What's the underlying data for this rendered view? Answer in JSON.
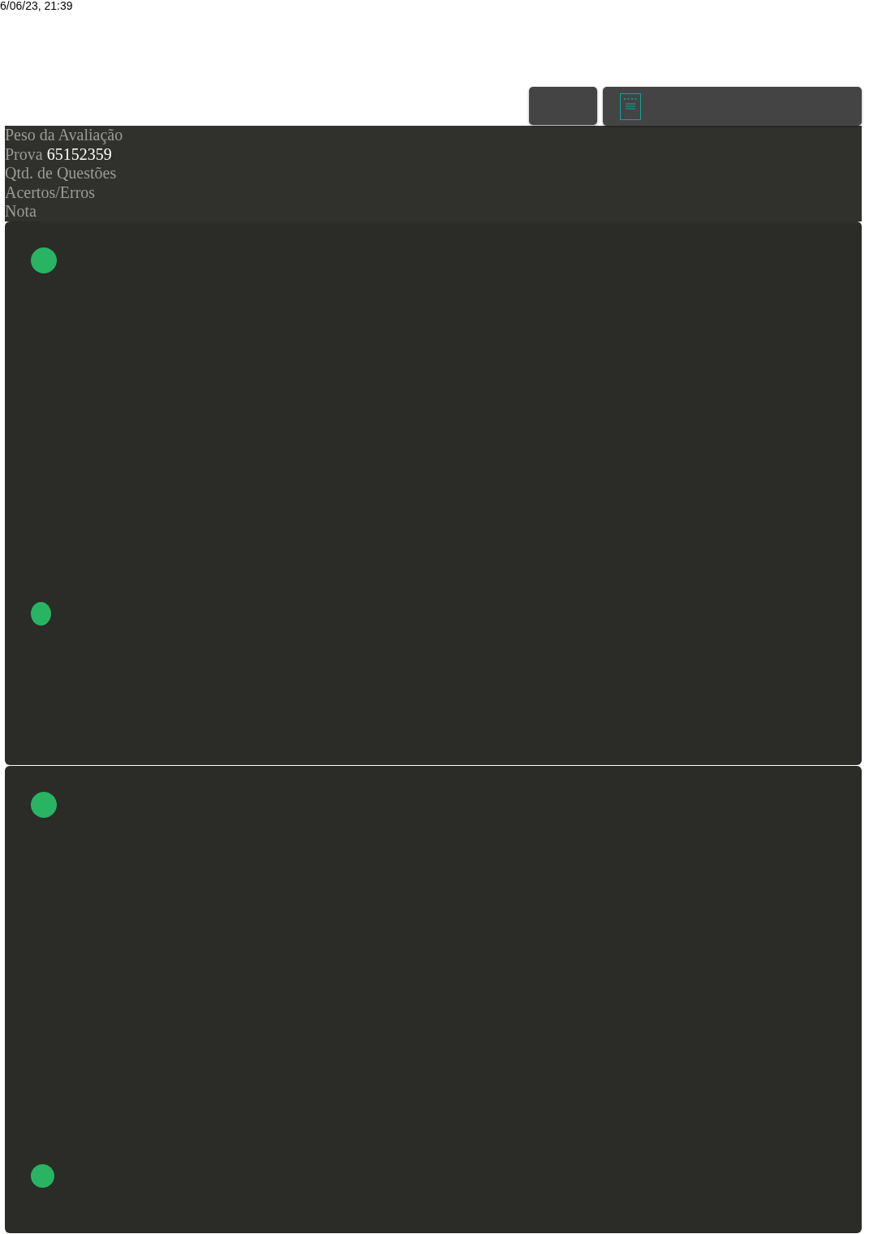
{
  "timestamp": "6/06/23, 21:39",
  "info": [
    {
      "label": "Peso da Avaliação"
    },
    {
      "label": "Prova",
      "value": "65152359"
    },
    {
      "label": "Qtd. de Questões"
    },
    {
      "label": "Acertos/Erros"
    },
    {
      "label": "Nota"
    }
  ],
  "cards": [
    {
      "kind": "question"
    },
    {
      "kind": "question"
    }
  ]
}
